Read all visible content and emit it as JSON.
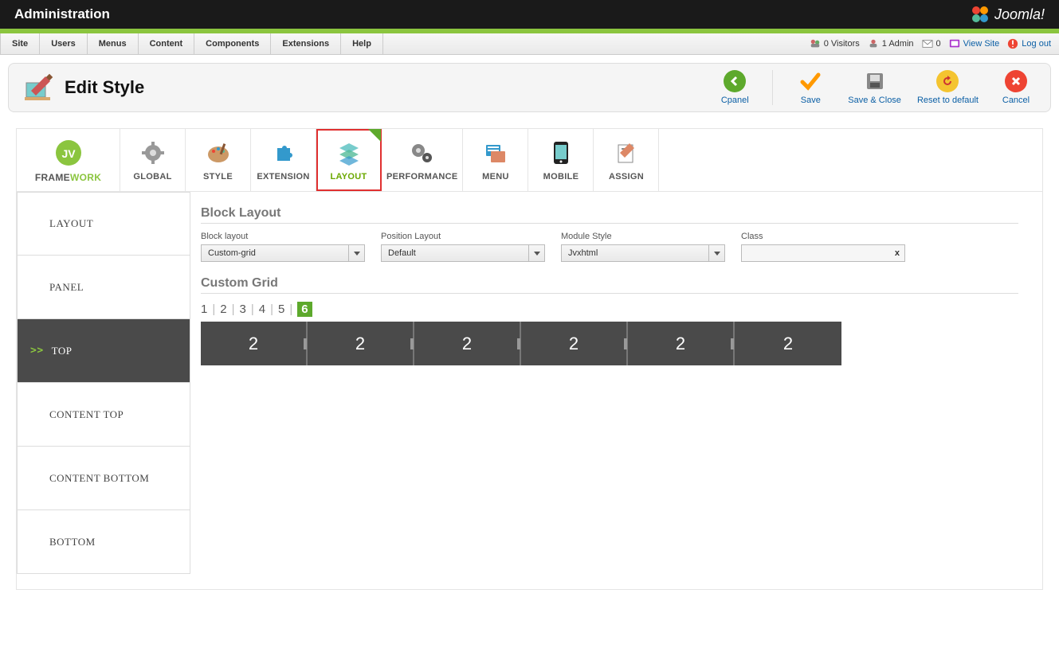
{
  "header": {
    "title": "Administration",
    "brand": "Joomla!"
  },
  "menubar": {
    "items": [
      "Site",
      "Users",
      "Menus",
      "Content",
      "Components",
      "Extensions",
      "Help"
    ],
    "visitors": "0 Visitors",
    "admin": "1 Admin",
    "messages": "0",
    "view_site": "View Site",
    "logout": "Log out"
  },
  "page": {
    "title": "Edit Style"
  },
  "actions": {
    "cpanel": "Cpanel",
    "save": "Save",
    "save_close": "Save & Close",
    "reset": "Reset to default",
    "cancel": "Cancel"
  },
  "tabs": [
    {
      "label_a": "FRAME",
      "label_b": "WORK"
    },
    {
      "label": "GLOBAL"
    },
    {
      "label": "STYLE"
    },
    {
      "label": "EXTENSION"
    },
    {
      "label": "LAYOUT",
      "active": true
    },
    {
      "label": "PERFORMANCE"
    },
    {
      "label": "MENU"
    },
    {
      "label": "MOBILE"
    },
    {
      "label": "ASSIGN"
    }
  ],
  "sidebar": {
    "items": [
      {
        "label": "LAYOUT"
      },
      {
        "label": "PANEL"
      },
      {
        "label": "TOP",
        "active": true
      },
      {
        "label": "CONTENT TOP"
      },
      {
        "label": "CONTENT BOTTOM"
      },
      {
        "label": "BOTTOM"
      }
    ]
  },
  "block_layout": {
    "title": "Block Layout",
    "fields": {
      "block_layout": {
        "label": "Block layout",
        "value": "Custom-grid"
      },
      "position_layout": {
        "label": "Position Layout",
        "value": "Default"
      },
      "module_style": {
        "label": "Module Style",
        "value": "Jvxhtml"
      },
      "class": {
        "label": "Class",
        "value": ""
      }
    }
  },
  "custom_grid": {
    "title": "Custom Grid",
    "counts": [
      "1",
      "2",
      "3",
      "4",
      "5",
      "6"
    ],
    "active_index": 5,
    "cells": [
      "2",
      "2",
      "2",
      "2",
      "2",
      "2"
    ]
  }
}
